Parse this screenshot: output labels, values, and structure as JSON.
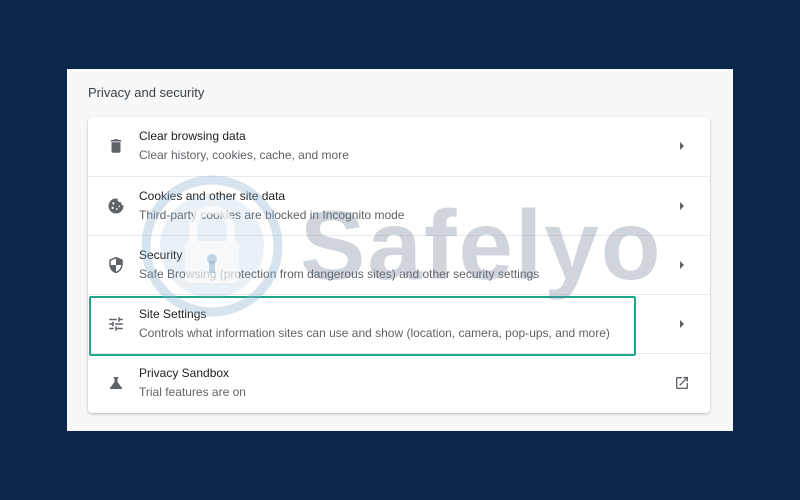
{
  "section_title": "Privacy and security",
  "rows": [
    {
      "title": "Clear browsing data",
      "subtitle": "Clear history, cookies, cache, and more",
      "icon": "trash-icon",
      "action": "chevron-right-icon"
    },
    {
      "title": "Cookies and other site data",
      "subtitle": "Third-party cookies are blocked in Incognito mode",
      "icon": "cookie-icon",
      "action": "chevron-right-icon"
    },
    {
      "title": "Security",
      "subtitle": "Safe Browsing (protection from dangerous sites) and other security settings",
      "icon": "shield-icon",
      "action": "chevron-right-icon"
    },
    {
      "title": "Site Settings",
      "subtitle": "Controls what information sites can use and show (location, camera, pop-ups, and more)",
      "icon": "tune-icon",
      "action": "chevron-right-icon"
    },
    {
      "title": "Privacy Sandbox",
      "subtitle": "Trial features are on",
      "icon": "flask-icon",
      "action": "open-in-new-icon"
    }
  ],
  "watermark": {
    "text": "Safelyo",
    "icon": "lock-icon"
  },
  "colors": {
    "background": "#0b2649",
    "panel": "#f7f8fa",
    "card": "#ffffff",
    "highlight": "#1fa98c",
    "icon": "#5f6368",
    "title_text": "#202124",
    "subtitle_text": "#5f6368"
  }
}
